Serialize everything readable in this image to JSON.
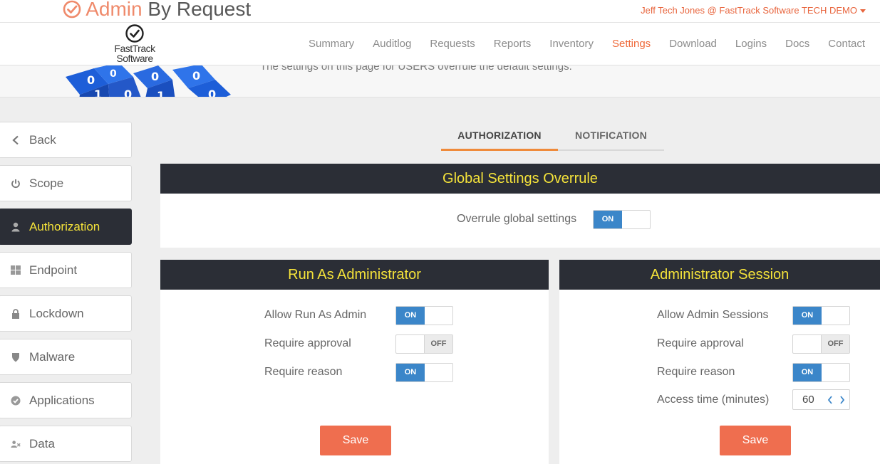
{
  "app": {
    "brand_part1": "Admin",
    "brand_part2": " By Request",
    "user_menu": "Jeff Tech Jones @ FastTrack Software TECH DEMO",
    "company_logo_line1": "FastTrack",
    "company_logo_line2": "Software",
    "accent_color": "#ef6a3a",
    "highlight_color": "#f5e33a"
  },
  "nav": [
    {
      "label": "Summary",
      "active": false
    },
    {
      "label": "Auditlog",
      "active": false
    },
    {
      "label": "Requests",
      "active": false
    },
    {
      "label": "Reports",
      "active": false
    },
    {
      "label": "Inventory",
      "active": false
    },
    {
      "label": "Settings",
      "active": true
    },
    {
      "label": "Download",
      "active": false
    },
    {
      "label": "Logins",
      "active": false
    },
    {
      "label": "Docs",
      "active": false
    },
    {
      "label": "Contact",
      "active": false
    }
  ],
  "banner": {
    "text": "The settings on this page for USERS overrule the default settings."
  },
  "sidebar": [
    {
      "label": "Back",
      "icon": "chevron-left-icon"
    },
    {
      "label": "Scope",
      "icon": "power-icon"
    },
    {
      "label": "Authorization",
      "icon": "user-icon"
    },
    {
      "label": "Endpoint",
      "icon": "windows-icon"
    },
    {
      "label": "Lockdown",
      "icon": "lock-icon"
    },
    {
      "label": "Malware",
      "icon": "shield-icon"
    },
    {
      "label": "Applications",
      "icon": "check-circle-icon"
    },
    {
      "label": "Data",
      "icon": "user-x-icon"
    }
  ],
  "tabs": [
    "AUTHORIZATION",
    "NOTIFICATION"
  ],
  "global": {
    "title": "Global Settings Overrule",
    "overrule_label": "Overrule global settings",
    "overrule_state": "ON"
  },
  "run_as_admin": {
    "title": "Run As Administrator",
    "rows": [
      {
        "label": "Allow Run As Admin",
        "state": "ON"
      },
      {
        "label": "Require approval",
        "state": "OFF"
      },
      {
        "label": "Require reason",
        "state": "ON"
      }
    ],
    "save_label": "Save"
  },
  "admin_session": {
    "title": "Administrator Session",
    "rows": [
      {
        "label": "Allow Admin Sessions",
        "state": "ON"
      },
      {
        "label": "Require approval",
        "state": "OFF"
      },
      {
        "label": "Require reason",
        "state": "ON"
      }
    ],
    "access_time_label": "Access time (minutes)",
    "access_time_value": "60",
    "save_label": "Save"
  }
}
